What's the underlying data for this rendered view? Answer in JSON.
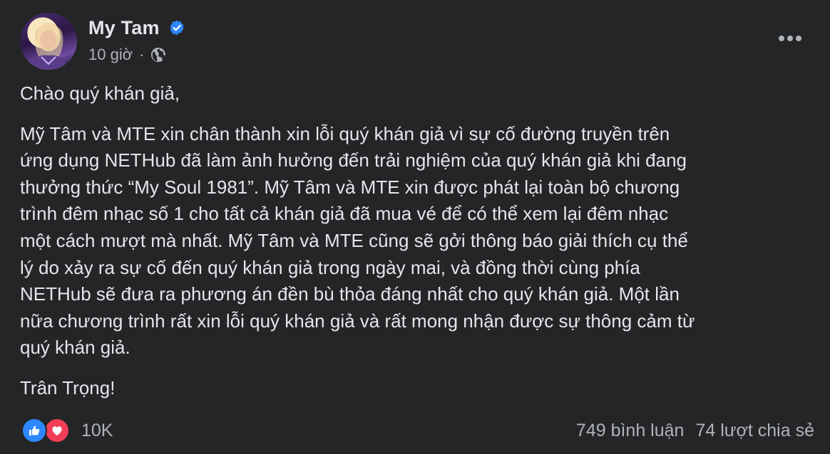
{
  "header": {
    "name": "My Tam",
    "time": "10 giờ",
    "separator": "·"
  },
  "post": {
    "paragraphs": [
      [
        "Chào quý khán giả,"
      ],
      [
        "Mỹ Tâm và MTE xin chân thành xin lỗi quý khán giả vì sự cố đường truyền trên",
        "ứng dụng NETHub đã làm ảnh hưởng đến trải nghiệm của quý khán giả khi đang",
        "thưởng thức “My Soul 1981”. Mỹ Tâm và MTE xin được phát lại toàn bộ chương",
        "trình đêm nhạc số 1 cho tất cả khán giả đã mua vé để có thể xem lại đêm nhạc",
        "một cách mượt mà nhất. Mỹ Tâm và MTE cũng sẽ gởi thông báo giải thích cụ thể",
        "lý do xảy ra sự cố đến quý khán giả trong ngày mai, và đồng thời cùng phía",
        "NETHub sẽ đưa ra phương án đền bù thỏa đáng nhất cho quý khán giả. Một lần",
        "nữa chương trình rất xin lỗi quý khán giả và rất mong nhận được sự thông cảm từ",
        "quý khán giả."
      ],
      [
        "Trân Trọng!"
      ]
    ]
  },
  "footer": {
    "reaction_count": "10K",
    "comments": "749 bình luận",
    "shares": "74 lượt chia sẻ"
  },
  "icons": {
    "verified": "verified-badge-icon",
    "audience": "globe-icon",
    "more": "more-options-icon",
    "like": "like-reaction-icon",
    "love": "love-reaction-icon"
  },
  "colors": {
    "background": "#242526",
    "text_primary": "#e4e6eb",
    "text_secondary": "#b0b3b8",
    "like_blue": "#2d88ff",
    "love_red": "#f33e58"
  }
}
